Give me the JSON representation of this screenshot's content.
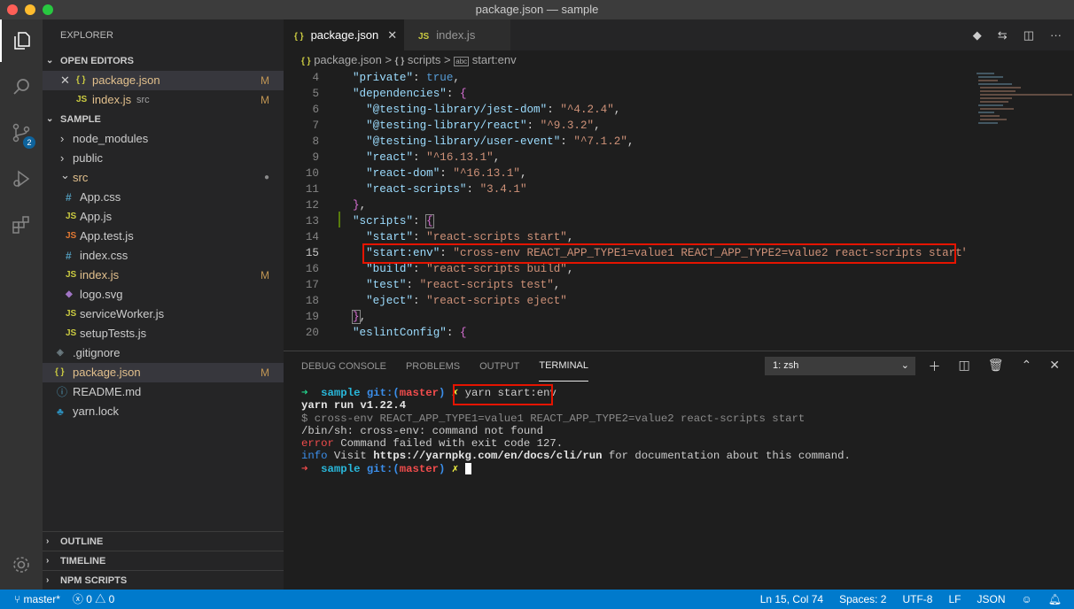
{
  "window": {
    "title": "package.json — sample",
    "lights": {
      "close": "#ff5f57",
      "min": "#febc2e",
      "max": "#28c840"
    }
  },
  "activity": {
    "items": [
      "explorer-icon",
      "search-icon",
      "source-control-icon",
      "run-debug-icon",
      "extensions-icon"
    ],
    "scm_badge": "2",
    "bottom": "gear-icon"
  },
  "sidebar": {
    "title": "EXPLORER",
    "open_editors": {
      "label": "OPEN EDITORS",
      "items": [
        {
          "icon": "{ }",
          "name": "package.json",
          "sub": "",
          "status": "M"
        },
        {
          "icon": "JS",
          "name": "index.js",
          "sub": "src",
          "status": "M"
        }
      ]
    },
    "sample": {
      "label": "SAMPLE",
      "items": [
        {
          "icon": "›",
          "name": "node_modules",
          "status": ""
        },
        {
          "icon": "›",
          "name": "public",
          "status": ""
        },
        {
          "icon": "⌄",
          "name": "src",
          "status": "●"
        },
        {
          "icon": "#",
          "name": "App.css",
          "status": ""
        },
        {
          "icon": "JS",
          "name": "App.js",
          "status": ""
        },
        {
          "icon": "JS",
          "name": "App.test.js",
          "status": ""
        },
        {
          "icon": "#",
          "name": "index.css",
          "status": ""
        },
        {
          "icon": "JS",
          "name": "index.js",
          "status": "M"
        },
        {
          "icon": "◆",
          "name": "logo.svg",
          "status": ""
        },
        {
          "icon": "JS",
          "name": "serviceWorker.js",
          "status": ""
        },
        {
          "icon": "JS",
          "name": "setupTests.js",
          "status": ""
        },
        {
          "icon": "◈",
          "name": ".gitignore",
          "status": ""
        },
        {
          "icon": "{ }",
          "name": "package.json",
          "status": "M"
        },
        {
          "icon": "ⓘ",
          "name": "README.md",
          "status": ""
        },
        {
          "icon": "♣",
          "name": "yarn.lock",
          "status": ""
        }
      ]
    },
    "outline": "OUTLINE",
    "timeline": "TIMELINE",
    "npm": "NPM SCRIPTS"
  },
  "editor": {
    "tabs": [
      {
        "icon": "{ }",
        "label": "package.json",
        "close": "✕"
      },
      {
        "icon": "JS",
        "label": "index.js"
      }
    ],
    "breadcrumb": {
      "file": "package.json",
      "sep": ">",
      "p1": "scripts",
      "p2": "start:env",
      "icon_file": "{ }",
      "icon_p1": "{ }",
      "icon_p2": "abc"
    },
    "line_numbers": [
      "4",
      "5",
      "6",
      "7",
      "8",
      "9",
      "10",
      "11",
      "12",
      "13",
      "14",
      "15",
      "16",
      "17",
      "18",
      "19",
      "20"
    ]
  },
  "panel": {
    "tabs": [
      "DEBUG CONSOLE",
      "PROBLEMS",
      "OUTPUT",
      "TERMINAL"
    ],
    "terminal_select": "1: zsh",
    "lines": {
      "l1_arrow": "➜",
      "l1_dir": "sample",
      "l1_git": "git:(",
      "l1_branch": "master",
      "l1_close": ")",
      "l1_x": "✗",
      "l1_cmd": "yarn start:env",
      "l2": "yarn run v1.22.4",
      "l3": "$ cross-env REACT_APP_TYPE1=value1 REACT_APP_TYPE2=value2 react-scripts start",
      "l4": "/bin/sh: cross-env: command not found",
      "l5_tag": "error",
      "l5": " Command failed with exit code 127.",
      "l6_tag": "info",
      "l6_a": " Visit ",
      "l6_url": "https://yarnpkg.com/en/docs/cli/run",
      "l6_b": " for documentation about this command.",
      "l7_arrow": "➜",
      "l7_dir": "sample",
      "l7_git": "git:(",
      "l7_branch": "master",
      "l7_close": ")",
      "l7_x": "✗"
    }
  },
  "status": {
    "branch": "master*",
    "errors": "0",
    "warnings": "0",
    "position": "Ln 15, Col 74",
    "spaces": "Spaces: 2",
    "encoding": "UTF-8",
    "eol": "LF",
    "lang": "JSON"
  }
}
